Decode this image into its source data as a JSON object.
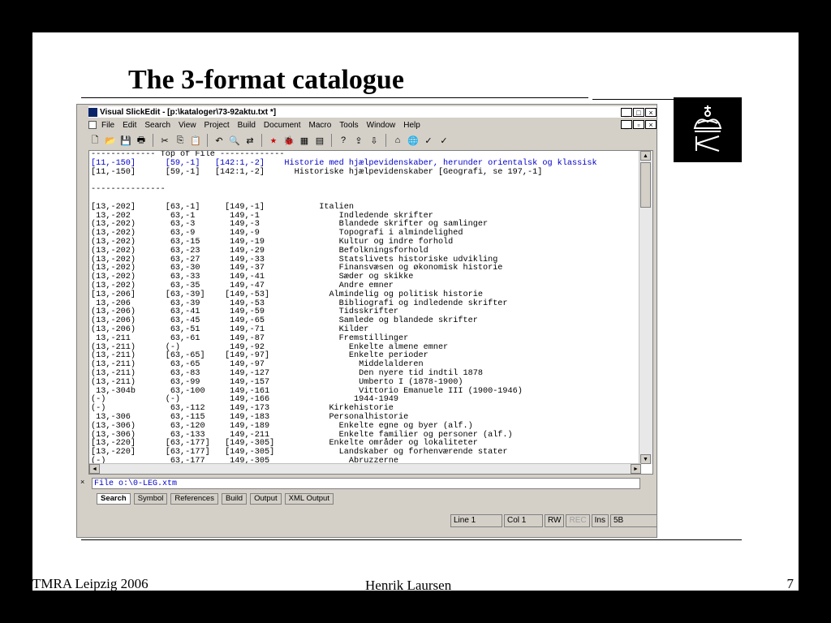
{
  "slide": {
    "title": "The 3-format catalogue",
    "footer_left": "TMRA Leipzig 2006",
    "footer_center": "Henrik Laursen",
    "page_number": "7"
  },
  "window": {
    "title": "Visual SlickEdit - [p:\\kataloger\\73-92aktu.txt *]",
    "menu": [
      "File",
      "Edit",
      "Search",
      "View",
      "Project",
      "Build",
      "Document",
      "Macro",
      "Tools",
      "Window",
      "Help"
    ],
    "editor_lines": [
      {
        "text": "------------- Top of File -------------",
        "blue": false
      },
      {
        "text": "[11,-150]      [59,-1]   [142:1,-2]    Historie med hjælpevidenskaber, herunder orientalsk og klassisk",
        "blue": true
      },
      {
        "text": "[11,-150]      [59,-1]   [142:1,-2]      Historiske hjælpevidenskaber [Geografi, se 197,-1]",
        "blue": false
      },
      {
        "text": "",
        "blue": false
      },
      {
        "text": "---------------",
        "blue": false
      },
      {
        "text": "",
        "blue": false
      },
      {
        "text": "[13,-202]      [63,-1]     [149,-1]           Italien",
        "blue": false
      },
      {
        "text": " 13,-202        63,-1       149,-1                Indledende skrifter",
        "blue": false
      },
      {
        "text": "(13,-202)       63,-3       149,-3                Blandede skrifter og samlinger",
        "blue": false
      },
      {
        "text": "(13,-202)       63,-9       149,-9                Topografi i almindelighed",
        "blue": false
      },
      {
        "text": "(13,-202)       63,-15      149,-19               Kultur og indre forhold",
        "blue": false
      },
      {
        "text": "(13,-202)       63,-23      149,-29               Befolkningsforhold",
        "blue": false
      },
      {
        "text": "(13,-202)       63,-27      149,-33               Statslivets historiske udvikling",
        "blue": false
      },
      {
        "text": "(13,-202)       63,-30      149,-37               Finansvæsen og økonomisk historie",
        "blue": false
      },
      {
        "text": "(13,-202)       63,-33      149,-41               Sæder og skikke",
        "blue": false
      },
      {
        "text": "(13,-202)       63,-35      149,-47               Andre emner",
        "blue": false
      },
      {
        "text": "[13,-206]      [63,-39]    [149,-53]            Almindelig og politisk historie",
        "blue": false
      },
      {
        "text": " 13,-206        63,-39      149,-53               Bibliografi og indledende skrifter",
        "blue": false
      },
      {
        "text": "(13,-206)       63,-41      149,-59               Tidsskrifter",
        "blue": false
      },
      {
        "text": "(13,-206)       63,-45      149,-65               Samlede og blandede skrifter",
        "blue": false
      },
      {
        "text": "(13,-206)       63,-51      149,-71               Kilder",
        "blue": false
      },
      {
        "text": " 13,-211        63,-61      149,-87               Fremstillinger",
        "blue": false
      },
      {
        "text": "(13,-211)      (-)          149,-92                 Enkelte almene emner",
        "blue": false
      },
      {
        "text": "(13,-211)      [63,-65]    [149,-97]                Enkelte perioder",
        "blue": false
      },
      {
        "text": "(13,-211)       63,-65      149,-97                   Middelalderen",
        "blue": false
      },
      {
        "text": "(13,-211)       63,-83      149,-127                  Den nyere tid indtil 1878",
        "blue": false
      },
      {
        "text": "(13,-211)       63,-99      149,-157                  Umberto I (1878-1900)",
        "blue": false
      },
      {
        "text": " 13,-304b       63,-100     149,-161                  Vittorio Emanuele III (1900-1946)",
        "blue": false
      },
      {
        "text": "(-)            (-)          149,-166                 1944-1949",
        "blue": false
      },
      {
        "text": "(-)             63,-112     149,-173            Kirkehistorie",
        "blue": false
      },
      {
        "text": " 13,-306        63,-115     149,-183            Personalhistorie",
        "blue": false
      },
      {
        "text": "(13,-306)       63,-120     149,-189              Enkelte egne og byer (alf.)",
        "blue": false
      },
      {
        "text": "(13,-306)       63,-133     149,-211              Enkelte familier og personer (alf.)",
        "blue": false
      },
      {
        "text": "[13,-220]      [63,-177]   [149,-305]           Enkelte områder og lokaliteter",
        "blue": false
      },
      {
        "text": "[13,-220]      [63,-177]   [149,-305]             Landskaber og forhenværende stater",
        "blue": false
      },
      {
        "text": "(-)             63,-177     149,-305                Abruzzerne",
        "blue": false
      }
    ],
    "output_file": "File o:\\0-LEG.xtm",
    "tabs": [
      "Search",
      "Symbol",
      "References",
      "Build",
      "Output",
      "XML Output"
    ],
    "status": {
      "line": "Line 1",
      "col": "Col 1",
      "rw": "RW",
      "rec": "REC",
      "ins": "Ins",
      "extra": "5B"
    }
  }
}
